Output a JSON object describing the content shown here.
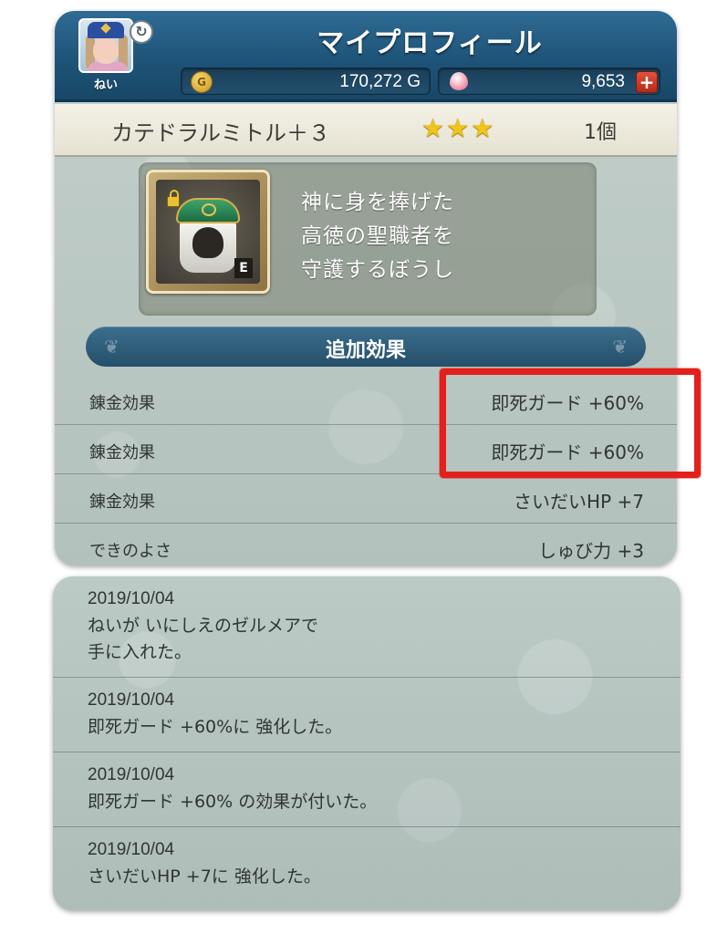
{
  "header": {
    "title": "マイプロフィール",
    "player_name": "ねい",
    "gold": "170,272 G",
    "gems": "9,653",
    "plus_label": "+",
    "coin_label": "G",
    "refresh_glyph": "↻"
  },
  "item": {
    "name": "カテドラルミトル＋３",
    "stars": "★★★",
    "count": "1個",
    "equipped_badge": "E",
    "description": "神に身を捧げた\n高徳の聖職者を\n守護するぼうし"
  },
  "effects": {
    "section_title": "追加効果",
    "rows": [
      {
        "label": "錬金効果",
        "value": "即死ガード +60%"
      },
      {
        "label": "錬金効果",
        "value": "即死ガード +60%"
      },
      {
        "label": "錬金効果",
        "value": "さいだいHP +7"
      },
      {
        "label": "できのよさ",
        "value": "しゅび力 +3"
      }
    ]
  },
  "history": [
    {
      "date": "2019/10/04",
      "text": "ねいが いにしえのゼルメアで\n手に入れた。"
    },
    {
      "date": "2019/10/04",
      "text": "即死ガード +60%に 強化した。"
    },
    {
      "date": "2019/10/04",
      "text": "即死ガード +60% の効果が付いた。"
    },
    {
      "date": "2019/10/04",
      "text": "さいだいHP +7に 強化した。"
    }
  ],
  "colors": {
    "header_blue": "#1e5479",
    "highlight_red": "#e3201b",
    "star_gold": "#f0c418"
  },
  "icons": [
    "refresh-icon",
    "coin-icon",
    "gem-icon",
    "plus-icon",
    "lock-icon",
    "mitre-icon",
    "star-icon"
  ]
}
